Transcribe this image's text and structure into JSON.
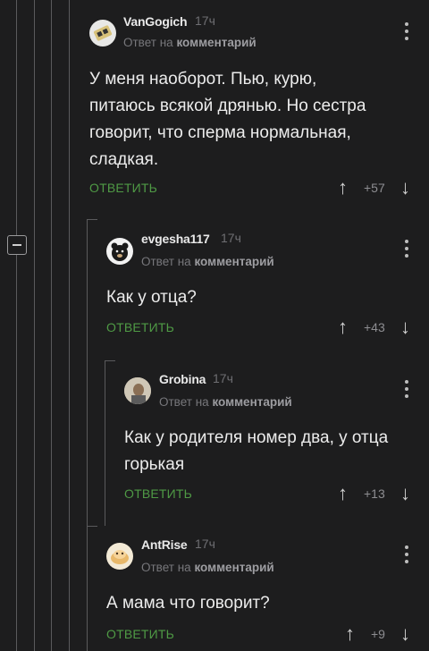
{
  "comments": [
    {
      "username": "VanGogich",
      "time": "17ч",
      "reply_prefix": "Ответ на",
      "reply_target": "комментарий",
      "text_lines": [
        "У меня наоборот. Пью, курю,",
        "питаюсь всякой дрянью. Но сестра",
        "говорит, что сперма нормальная,",
        "сладкая."
      ],
      "reply_label": "ОТВЕТИТЬ",
      "score": "+57"
    },
    {
      "username": "evgesha117",
      "time": "17ч",
      "reply_prefix": "Ответ на",
      "reply_target": "комментарий",
      "text_lines": [
        "Как у отца?"
      ],
      "reply_label": "ОТВЕТИТЬ",
      "score": "+43"
    },
    {
      "username": "Grobina",
      "time": "17ч",
      "reply_prefix": "Ответ на",
      "reply_target": "комментарий",
      "text_lines": [
        "Как у родителя номер два, у отца",
        "горькая"
      ],
      "reply_label": "ОТВЕТИТЬ",
      "score": "+13"
    },
    {
      "username": "AntRise",
      "time": "17ч",
      "reply_prefix": "Ответ на",
      "reply_target": "комментарий",
      "text_lines": [
        "А мама что говорит?"
      ],
      "reply_label": "ОТВЕТИТЬ",
      "score": "+9"
    }
  ],
  "colors": {
    "background": "#1d1d1e",
    "reply_green": "#4f9a45",
    "thread_line": "#5a5a5c"
  },
  "icons": [
    "collapse-icon",
    "kebab-menu-icon",
    "upvote-arrow-icon",
    "downvote-arrow-icon",
    "avatar"
  ]
}
